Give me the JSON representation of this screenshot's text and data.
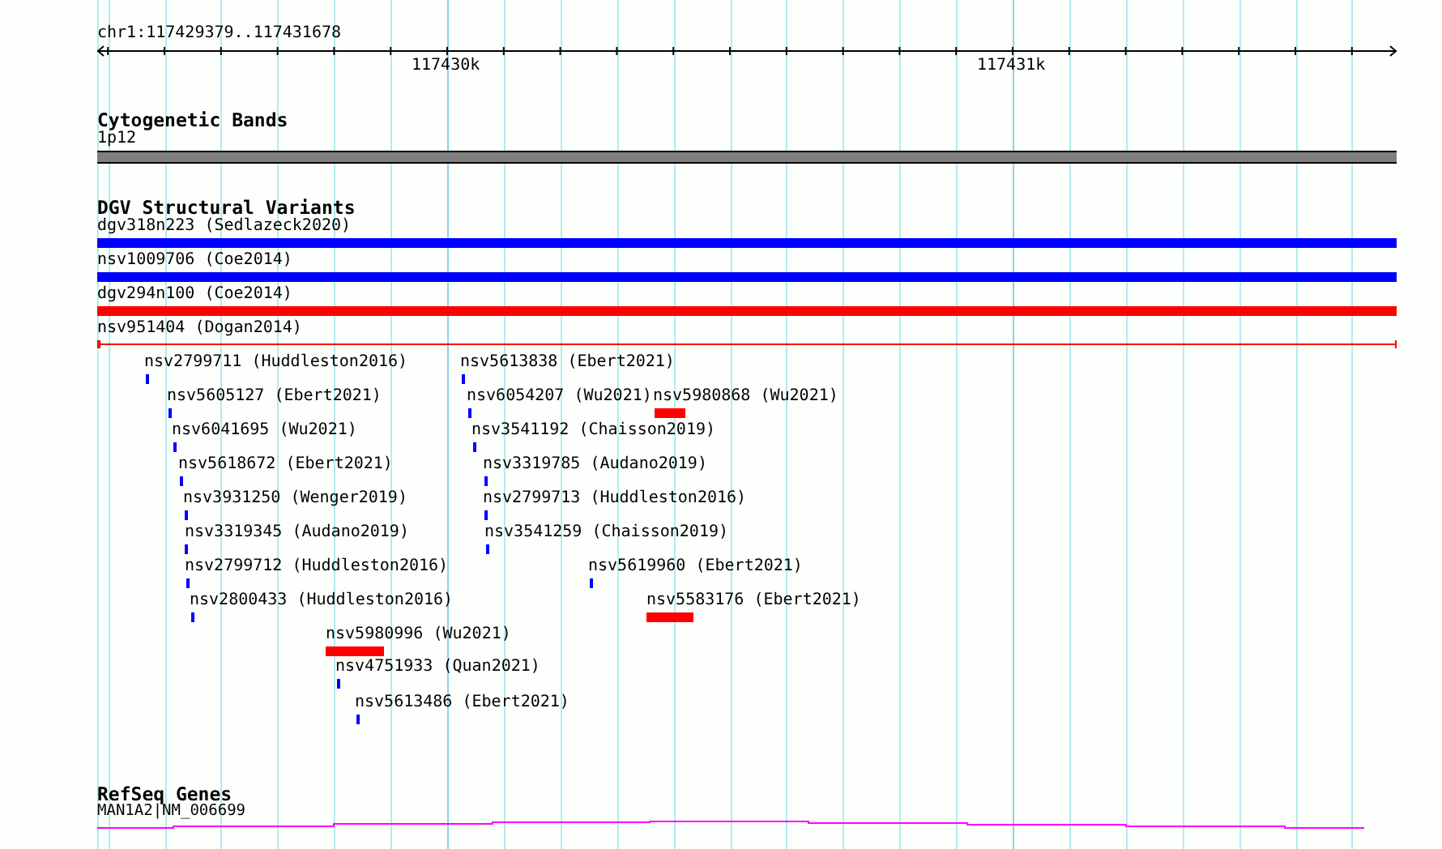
{
  "ruler": {
    "location": "chr1:117429379..117431678",
    "tick_labels": [
      "117430k",
      "117431k"
    ]
  },
  "cytogenetic_bands": {
    "title": "Cytogenetic Bands",
    "features": [
      {
        "label": "1p12",
        "color": "#808080"
      }
    ]
  },
  "dgv_structural_variants": {
    "title": "DGV Structural Variants",
    "features": [
      {
        "label": "dgv318n223 (Sedlazeck2020)",
        "kind": "bar",
        "color": "#0000ff"
      },
      {
        "label": "nsv1009706 (Coe2014)",
        "kind": "bar",
        "color": "#0000ff"
      },
      {
        "label": "dgv294n100 (Coe2014)",
        "kind": "bar",
        "color": "#ff0000"
      },
      {
        "label": "nsv951404 (Dogan2014)",
        "kind": "line",
        "color": "#ff0000"
      },
      {
        "label": "nsv2799711 (Huddleston2016)",
        "kind": "bar",
        "color": "#0000ff"
      },
      {
        "label": "nsv5605127 (Ebert2021)",
        "kind": "bar",
        "color": "#0000ff"
      },
      {
        "label": "nsv6041695 (Wu2021)",
        "kind": "bar",
        "color": "#0000ff"
      },
      {
        "label": "nsv5618672 (Ebert2021)",
        "kind": "bar",
        "color": "#0000ff"
      },
      {
        "label": "nsv3931250 (Wenger2019)",
        "kind": "bar",
        "color": "#0000ff"
      },
      {
        "label": "nsv3319345 (Audano2019)",
        "kind": "bar",
        "color": "#0000ff"
      },
      {
        "label": "nsv2799712 (Huddleston2016)",
        "kind": "bar",
        "color": "#0000ff"
      },
      {
        "label": "nsv2800433 (Huddleston2016)",
        "kind": "bar",
        "color": "#0000ff"
      },
      {
        "label": "nsv5980996 (Wu2021)",
        "kind": "bar",
        "color": "#ff0000"
      },
      {
        "label": "nsv4751933 (Quan2021)",
        "kind": "bar",
        "color": "#0000ff"
      },
      {
        "label": "nsv5613486 (Ebert2021)",
        "kind": "bar",
        "color": "#0000ff"
      },
      {
        "label": "nsv5613838 (Ebert2021)",
        "kind": "bar",
        "color": "#0000ff"
      },
      {
        "label": "nsv6054207 (Wu2021)",
        "kind": "bar",
        "color": "#0000ff"
      },
      {
        "label": "nsv5980868 (Wu2021)",
        "kind": "bar",
        "color": "#ff0000"
      },
      {
        "label": "nsv3541192 (Chaisson2019)",
        "kind": "bar",
        "color": "#0000ff"
      },
      {
        "label": "nsv3319785 (Audano2019)",
        "kind": "bar",
        "color": "#0000ff"
      },
      {
        "label": "nsv2799713 (Huddleston2016)",
        "kind": "bar",
        "color": "#0000ff"
      },
      {
        "label": "nsv3541259 (Chaisson2019)",
        "kind": "bar",
        "color": "#0000ff"
      },
      {
        "label": "nsv5619960 (Ebert2021)",
        "kind": "bar",
        "color": "#0000ff"
      },
      {
        "label": "nsv5583176 (Ebert2021)",
        "kind": "bar",
        "color": "#ff0000"
      }
    ]
  },
  "refseq_genes": {
    "title": "RefSeq Genes",
    "features": [
      {
        "label": "MAN1A2|NM_006699",
        "color": "#ff00ff"
      }
    ]
  }
}
